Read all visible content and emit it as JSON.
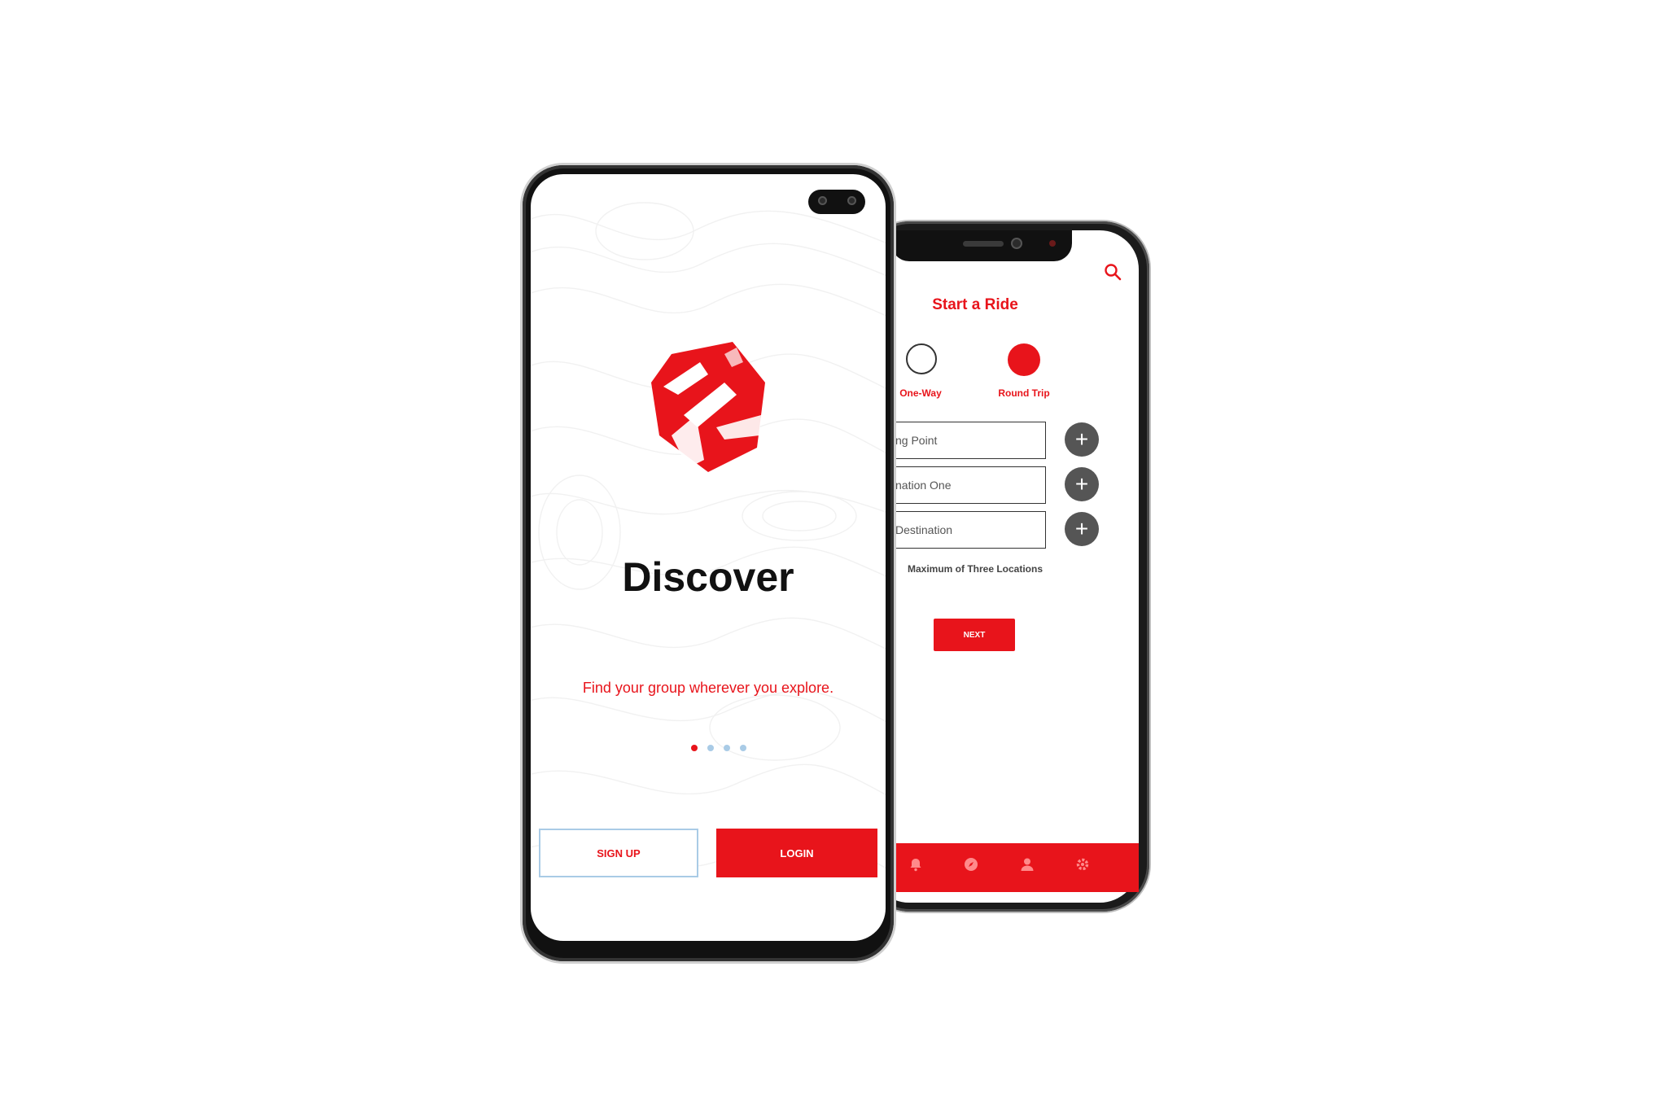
{
  "colors": {
    "accent": "#e8141b",
    "dot_inactive": "#a9cbe6",
    "plus_button": "#555555"
  },
  "front_screen": {
    "title": "Discover",
    "tagline": "Find your group wherever you explore.",
    "page_indicator": {
      "count": 4,
      "active_index": 0
    },
    "signup_label": "SIGN UP",
    "login_label": "LOGIN",
    "logo_icon": "shield-logo-icon"
  },
  "back_screen": {
    "title": "Start a Ride",
    "search_icon": "search-icon",
    "trip_options": [
      {
        "label": "One-Way",
        "selected": false
      },
      {
        "label": "Round Trip",
        "selected": true
      }
    ],
    "fields": [
      {
        "visible_text": "ng Point"
      },
      {
        "visible_text": "nation One"
      },
      {
        "visible_text": "Destination"
      }
    ],
    "max_note": "Maximum of Three Locations",
    "next_label": "NEXT",
    "tabbar_icons": [
      "bell-icon",
      "compass-icon",
      "user-icon",
      "gear-icon"
    ]
  }
}
